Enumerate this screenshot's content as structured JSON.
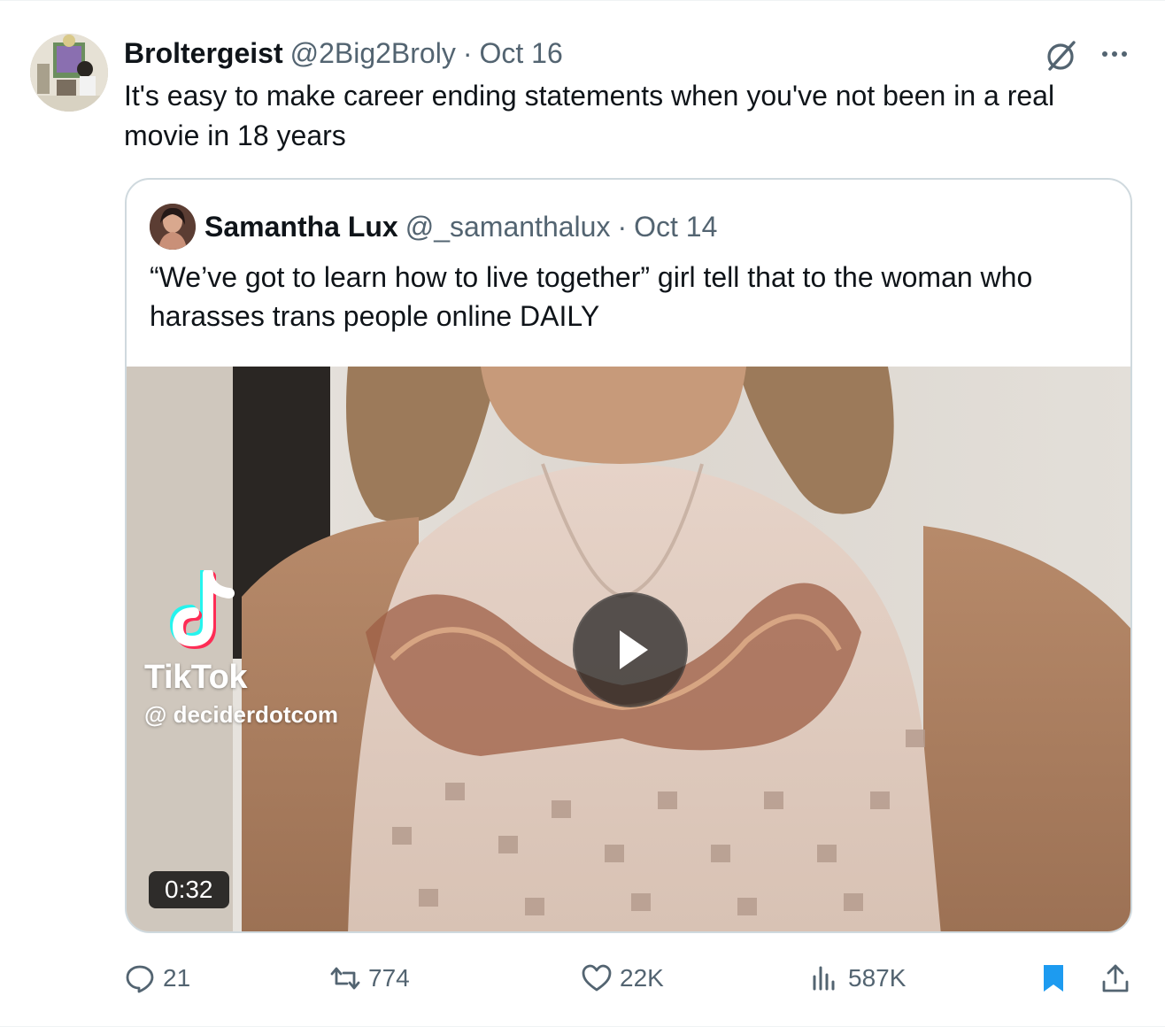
{
  "tweet": {
    "author": {
      "name": "Broltergeist",
      "handle": "@2Big2Broly",
      "separator": "·",
      "date": "Oct 16",
      "avatar_icon": "user-avatar"
    },
    "text": "It's easy to make career ending statements when you've not been in a real movie in 18 years",
    "header_icons": [
      "grok-icon",
      "more-icon"
    ]
  },
  "quote": {
    "author": {
      "name": "Samantha Lux",
      "handle": "@_samanthalux",
      "separator": "·",
      "date": "Oct 14",
      "avatar_icon": "user-avatar"
    },
    "text": "“We’ve got to learn how to live together” girl tell that to the woman who harasses trans people online DAILY",
    "video": {
      "watermark_brand": "TikTok",
      "watermark_handle": "@ deciderdotcom",
      "duration": "0:32",
      "play_icon": "play-icon"
    }
  },
  "actions": {
    "replies": "21",
    "reposts": "774",
    "likes": "22K",
    "views": "587K",
    "bookmark_icon": "bookmark-icon",
    "share_icon": "share-icon"
  },
  "colors": {
    "text_primary": "#0f1419",
    "text_secondary": "#536471",
    "border": "#cfd9de",
    "bookmark_active": "#1d9bf0"
  }
}
